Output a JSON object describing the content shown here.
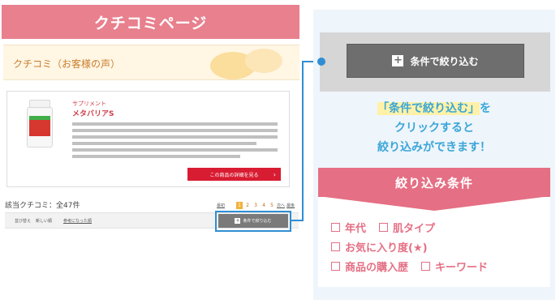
{
  "left_page": {
    "header_title": "クチコミページ",
    "banner_title": "クチコミ（お客様の声）",
    "product": {
      "category": "サプリメント",
      "name": "メタバリアS",
      "detail_button": "この商品の詳細を見る",
      "detail_chevron": "›"
    },
    "count_label": "該当クチコミ：全47件",
    "pager": {
      "first": "最初",
      "pages": [
        "1",
        "2",
        "3",
        "4",
        "5"
      ],
      "next": "次へ",
      "last": "最後"
    },
    "sort": {
      "label": "並び替え",
      "newest": "新しい順",
      "helpful": "参考になった順"
    },
    "filter_button": "条件で絞り込む"
  },
  "right_panel": {
    "filter_button": "条件で絞り込む",
    "explain_line1_highlight": "「条件で絞り込む」",
    "explain_line1_rest": "を",
    "explain_line2": "クリックすると",
    "explain_line3": "絞り込みができます！",
    "conditions_title": "絞り込み条件",
    "conditions": [
      [
        "年代",
        "肌タイプ"
      ],
      [
        "お気に入り度(★)"
      ],
      [
        "商品の購入歴",
        "キーワード"
      ]
    ]
  },
  "colors": {
    "pink": "#e56f84",
    "blue": "#2f8ed3",
    "text_blue": "#3aa6d9",
    "red_button": "#d81c32"
  }
}
